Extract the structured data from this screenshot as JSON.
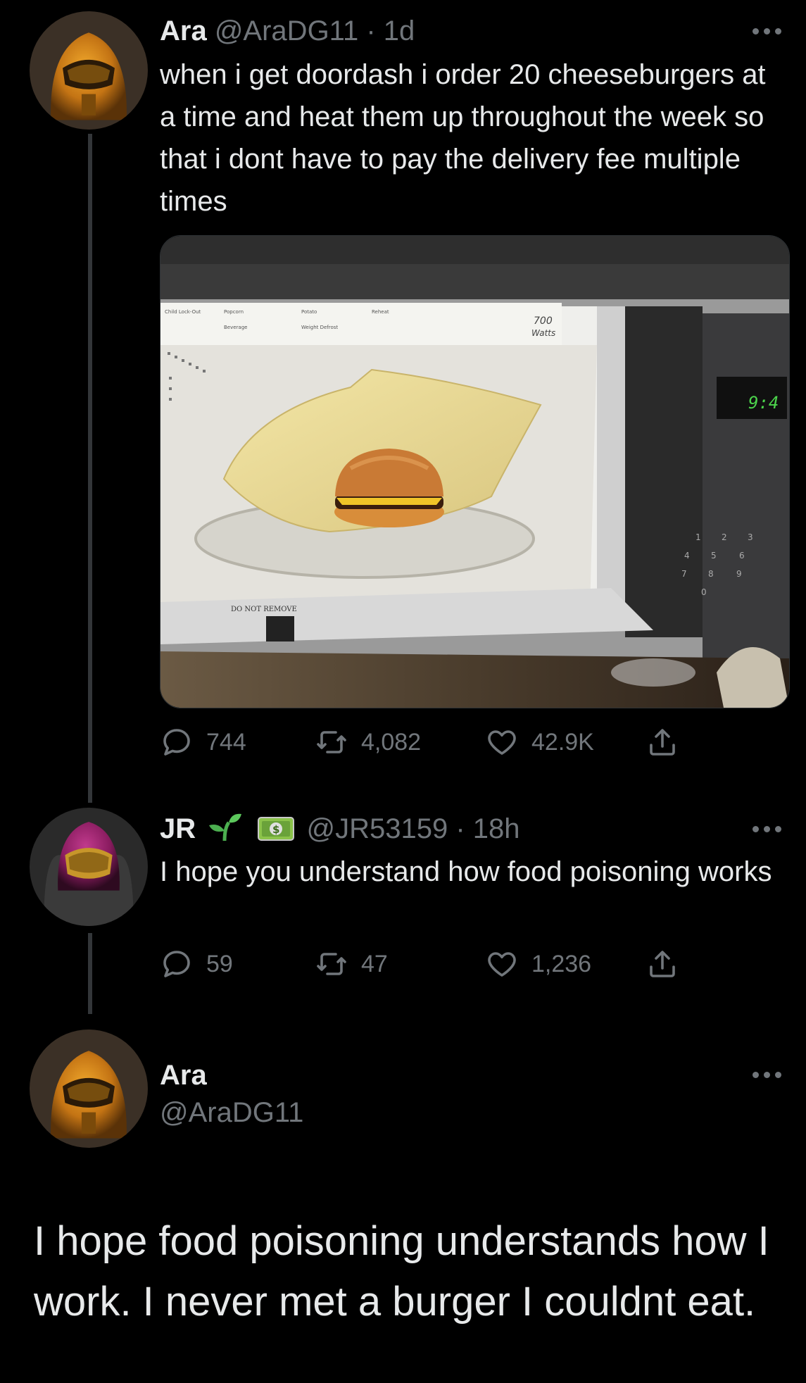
{
  "tweet1": {
    "name": "Ara",
    "handle": "@AraDG11",
    "time": "· 1d",
    "text": "when i get doordash i order 20 cheeseburgers at a time and heat them up throughout the week so that i dont have to pay the delivery fee multiple times",
    "replies": "744",
    "retweets": "4,082",
    "likes": "42.9K",
    "media": {
      "microwave_display": "9:4",
      "watts": "700",
      "watts_label": "Watts",
      "do_not_remove": "DO NOT REMOVE",
      "keypad": [
        "1",
        "2",
        "3",
        "4",
        "5",
        "6",
        "7",
        "8",
        "9",
        "0"
      ]
    }
  },
  "tweet2": {
    "name": "JR",
    "handle": "@JR53159",
    "time": "· 18h",
    "text": "I hope you understand how food poisoning works",
    "replies": "59",
    "retweets": "47",
    "likes": "1,236"
  },
  "tweet3": {
    "name": "Ara",
    "handle": "@AraDG11",
    "text": "I hope food poisoning understands how I work. I never met a burger I couldnt eat."
  },
  "icons": {
    "reply": "reply-icon",
    "retweet": "retweet-icon",
    "like": "heart-icon",
    "share": "share-icon",
    "more": "more-icon"
  },
  "colors": {
    "background": "#000000",
    "text": "#e7e9ea",
    "muted": "#71767b",
    "thread_line": "#333639"
  }
}
